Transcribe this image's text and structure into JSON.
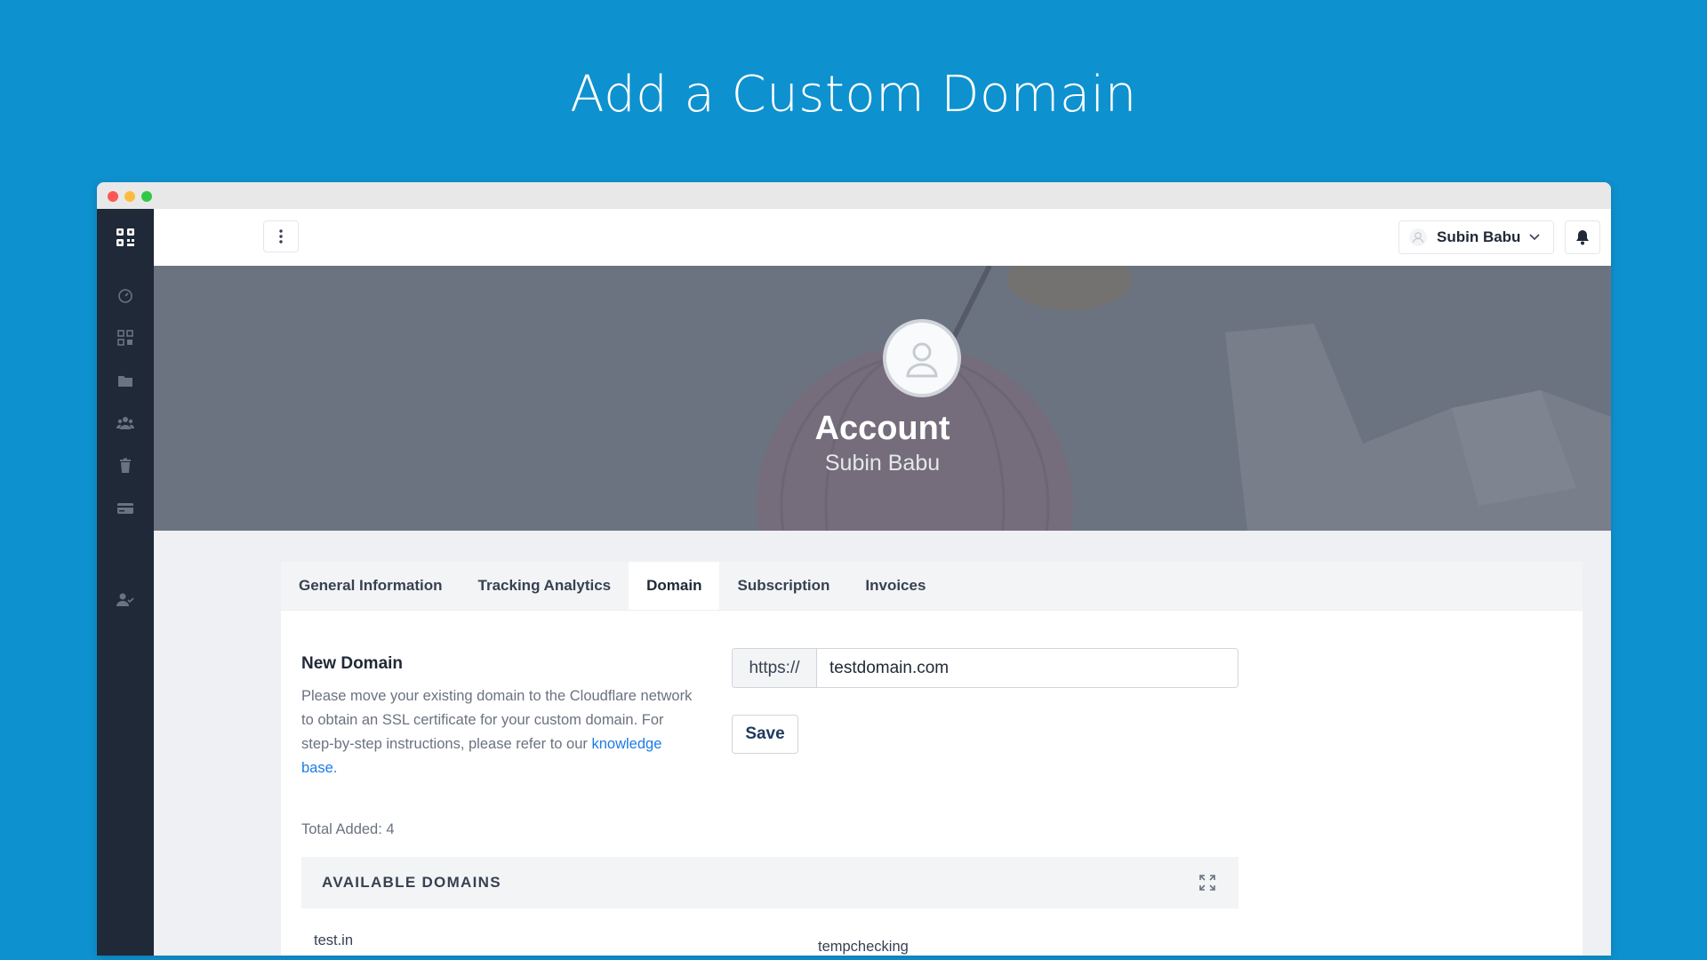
{
  "headline": "Add a Custom Domain",
  "sidebar": {
    "items": [
      {
        "icon": "dashboard-icon"
      },
      {
        "icon": "qr-code-icon"
      },
      {
        "icon": "folder-icon"
      },
      {
        "icon": "users-icon"
      },
      {
        "icon": "trash-icon"
      },
      {
        "icon": "credit-card-icon"
      },
      {
        "icon": "user-check-icon"
      }
    ]
  },
  "topbar": {
    "user_name": "Subin Babu"
  },
  "banner": {
    "title": "Account",
    "subtitle": "Subin Babu"
  },
  "tabs": [
    {
      "label": "General Information",
      "active": false
    },
    {
      "label": "Tracking Analytics",
      "active": false
    },
    {
      "label": "Domain",
      "active": true
    },
    {
      "label": "Subscription",
      "active": false
    },
    {
      "label": "Invoices",
      "active": false
    }
  ],
  "domain_form": {
    "title": "New Domain",
    "desc_text": "Please move your existing domain to the Cloudflare network to obtain an SSL certificate for your custom domain. For step-by-step instructions, please refer to our ",
    "desc_link": "knowledge base.",
    "url_prefix": "https://",
    "url_value": "testdomain.com",
    "save_label": "Save"
  },
  "domains": {
    "total_label": "Total Added: 4",
    "header": "AVAILABLE DOMAINS",
    "items": [
      "test.in",
      "tempchecking"
    ]
  },
  "colors": {
    "background": "#0e91cf",
    "sidebar": "#1f2937",
    "link": "#1d7be6"
  }
}
